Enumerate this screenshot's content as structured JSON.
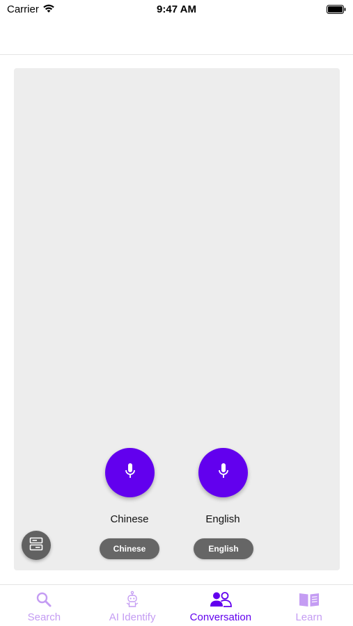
{
  "status_bar": {
    "carrier": "Carrier",
    "time": "9:47 AM",
    "icons": [
      "wifi-icon",
      "battery-icon"
    ]
  },
  "conversation": {
    "left": {
      "mic_icon": "microphone-icon",
      "language_label": "Chinese",
      "language_button": "Chinese"
    },
    "right": {
      "mic_icon": "microphone-icon",
      "language_label": "English",
      "language_button": "English"
    },
    "options_icon": "layout-icon"
  },
  "tab_bar": {
    "items": [
      {
        "label": "Search",
        "icon": "search-icon",
        "active": false
      },
      {
        "label": "AI Identify",
        "icon": "robot-icon",
        "active": false
      },
      {
        "label": "Conversation",
        "icon": "people-icon",
        "active": true
      },
      {
        "label": "Learn",
        "icon": "book-icon",
        "active": false
      }
    ]
  },
  "colors": {
    "accent": "#6200ee",
    "accent_light": "#c49cf3",
    "panel_bg": "#ededed",
    "pill_bg": "#666666"
  }
}
